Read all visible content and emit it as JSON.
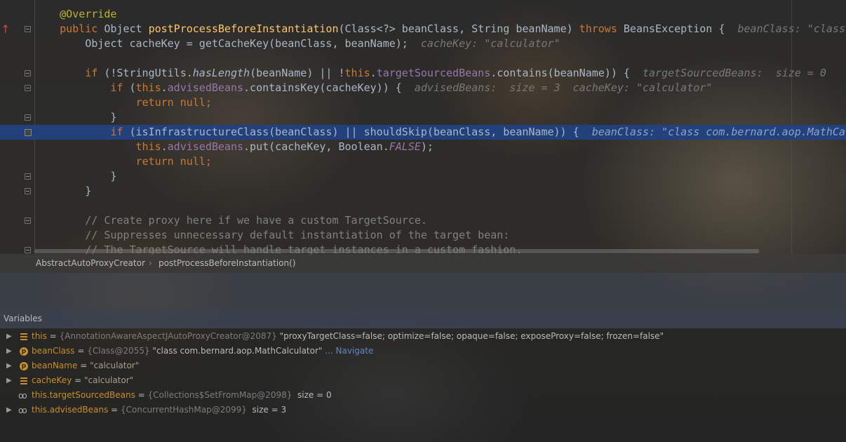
{
  "editor": {
    "lines": [
      {
        "parts": [
          {
            "t": "    "
          },
          {
            "t": "@Override",
            "c": "ann"
          }
        ]
      },
      {
        "parts": [
          {
            "t": "    "
          },
          {
            "t": "public",
            "c": "kw"
          },
          {
            "t": " Object "
          },
          {
            "t": "postProcessBeforeInstantiation",
            "c": "fn"
          },
          {
            "t": "(Class<?> beanClass, String beanName) "
          },
          {
            "t": "throws",
            "c": "kw"
          },
          {
            "t": " BeansException {  "
          },
          {
            "t": "beanClass: \"class",
            "c": "dbg"
          }
        ]
      },
      {
        "parts": [
          {
            "t": "        Object cacheKey = getCacheKey(beanClass, beanName);  "
          },
          {
            "t": "cacheKey: \"calculator\"",
            "c": "dbg"
          }
        ]
      },
      {
        "parts": [
          {
            "t": ""
          }
        ]
      },
      {
        "parts": [
          {
            "t": "        "
          },
          {
            "t": "if",
            "c": "kw"
          },
          {
            "t": " (!StringUtils."
          },
          {
            "t": "hasLength",
            "c": "ital"
          },
          {
            "t": "(beanName) || !"
          },
          {
            "t": "this",
            "c": "kw"
          },
          {
            "t": "."
          },
          {
            "t": "targetSourcedBeans",
            "c": "fld"
          },
          {
            "t": ".contains(beanName)) {  "
          },
          {
            "t": "targetSourcedBeans:  size = 0",
            "c": "dbg"
          }
        ]
      },
      {
        "parts": [
          {
            "t": "            "
          },
          {
            "t": "if",
            "c": "kw"
          },
          {
            "t": " ("
          },
          {
            "t": "this",
            "c": "kw"
          },
          {
            "t": "."
          },
          {
            "t": "advisedBeans",
            "c": "fld"
          },
          {
            "t": ".containsKey(cacheKey)) {  "
          },
          {
            "t": "advisedBeans:  size = 3  cacheKey: \"calculator\"",
            "c": "dbg"
          }
        ]
      },
      {
        "parts": [
          {
            "t": "                "
          },
          {
            "t": "return null",
            "c": "kw"
          },
          {
            "t": ";",
            "c": "kw"
          }
        ]
      },
      {
        "parts": [
          {
            "t": "            }"
          }
        ]
      },
      {
        "parts": [
          {
            "t": "            "
          },
          {
            "t": "if",
            "c": "kw"
          },
          {
            "t": " (isInfrastructureClass(beanClass) || shouldSkip(beanClass, beanName)) {  "
          },
          {
            "t": "beanClass: \"class com.bernard.aop.MathCal",
            "c": "dbg-hl"
          }
        ],
        "highlight": true
      },
      {
        "parts": [
          {
            "t": "                "
          },
          {
            "t": "this",
            "c": "kw"
          },
          {
            "t": "."
          },
          {
            "t": "advisedBeans",
            "c": "fld"
          },
          {
            "t": ".put(cacheKey, Boolean."
          },
          {
            "t": "FALSE",
            "c": "fld ital"
          },
          {
            "t": ");"
          }
        ]
      },
      {
        "parts": [
          {
            "t": "                "
          },
          {
            "t": "return null",
            "c": "kw"
          },
          {
            "t": ";",
            "c": "kw"
          }
        ]
      },
      {
        "parts": [
          {
            "t": "            }"
          }
        ]
      },
      {
        "parts": [
          {
            "t": "        }"
          }
        ]
      },
      {
        "parts": [
          {
            "t": ""
          }
        ]
      },
      {
        "parts": [
          {
            "t": "        "
          },
          {
            "t": "// Create proxy here if we have a custom TargetSource.",
            "c": "cmt"
          }
        ]
      },
      {
        "parts": [
          {
            "t": "        "
          },
          {
            "t": "// Suppresses unnecessary default instantiation of the target bean:",
            "c": "cmt"
          }
        ]
      },
      {
        "parts": [
          {
            "t": "        "
          },
          {
            "t": "// The TargetSource will handle target instances in a custom fashion.",
            "c": "cmt"
          }
        ]
      }
    ]
  },
  "breadcrumb": {
    "class_name": "AbstractAutoProxyCreator",
    "separator": "›",
    "method_name": "postProcessBeforeInstantiation()"
  },
  "variables": {
    "title": "Variables",
    "rows": [
      {
        "expand": "▶",
        "icon": "field-icon",
        "name": "this",
        "eq": " = ",
        "type": "{AnnotationAwareAspectJAutoProxyCreator@2087}",
        "value": " \"proxyTargetClass=false; optimize=false; opaque=false; exposeProxy=false; frozen=false\"",
        "link": ""
      },
      {
        "expand": "▶",
        "icon": "parameter-icon",
        "name": "beanClass",
        "eq": " = ",
        "type": "{Class@2055}",
        "value": " \"class com.bernard.aop.MathCalculator\"",
        "link": " ... Navigate"
      },
      {
        "expand": "▶",
        "icon": "parameter-icon",
        "name": "beanName",
        "eq": " = ",
        "type": "",
        "value": "\"calculator\"",
        "link": ""
      },
      {
        "expand": "▶",
        "icon": "field-icon",
        "name": "cacheKey",
        "eq": " = ",
        "type": "",
        "value": "\"calculator\"",
        "link": ""
      },
      {
        "expand": "",
        "icon": "watch-icon",
        "name": "this.targetSourcedBeans",
        "eq": " = ",
        "type": "{Collections$SetFromMap@2098}",
        "value": "  size = 0",
        "link": ""
      },
      {
        "expand": "▶",
        "icon": "watch-icon",
        "name": "this.advisedBeans",
        "eq": " = ",
        "type": "{ConcurrentHashMap@2099}",
        "value": "  size = 3",
        "link": ""
      }
    ]
  },
  "colors": {
    "keyword": "#cc7832",
    "annotation": "#bbb529",
    "method": "#ffc66d",
    "field": "#9876aa",
    "comment": "#808080",
    "selection": "#214283",
    "variable_name": "#c98d2c"
  }
}
